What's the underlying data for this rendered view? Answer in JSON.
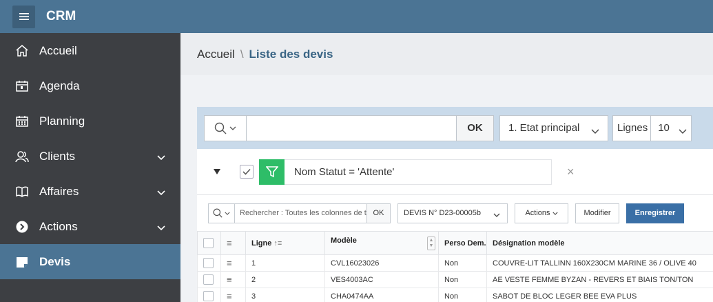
{
  "header": {
    "title": "CRM"
  },
  "sidebar": {
    "items": [
      {
        "label": "Accueil",
        "icon": "home-icon",
        "has_chevron": false,
        "active": false
      },
      {
        "label": "Agenda",
        "icon": "calendar-icon",
        "has_chevron": false,
        "active": false
      },
      {
        "label": "Planning",
        "icon": "planning-icon",
        "has_chevron": false,
        "active": false
      },
      {
        "label": "Clients",
        "icon": "users-icon",
        "has_chevron": true,
        "active": false
      },
      {
        "label": "Affaires",
        "icon": "book-icon",
        "has_chevron": true,
        "active": false
      },
      {
        "label": "Actions",
        "icon": "arrow-circle-icon",
        "has_chevron": true,
        "active": false
      },
      {
        "label": "Devis",
        "icon": "document-icon",
        "has_chevron": false,
        "active": true
      }
    ]
  },
  "breadcrumb": {
    "root": "Accueil",
    "separator": "\\",
    "current": "Liste des devis"
  },
  "search": {
    "value": "",
    "ok_label": "OK",
    "report_select": "1. Etat principal",
    "lines_label": "Lignes",
    "lines_value": "10"
  },
  "filter": {
    "text": "Nom Statut = 'Attente'",
    "close": "×"
  },
  "grid_toolbar": {
    "placeholder": "Rechercher : Toutes les colonnes de t",
    "ok_label": "OK",
    "report_select": "DEVIS N° D23-00005b",
    "actions_label": "Actions",
    "modify_label": "Modifier",
    "save_label": "Enregistrer"
  },
  "grid": {
    "columns": [
      "Ligne",
      "Modèle",
      "Perso Dem.",
      "Désignation modèle"
    ],
    "rows": [
      {
        "ligne": "1",
        "modele": "CVL16023026",
        "perso": "Non",
        "designation": "COUVRE-LIT TALLINN 160X230CM MARINE 36 / OLIVE 40"
      },
      {
        "ligne": "2",
        "modele": "VES4003AC",
        "perso": "Non",
        "designation": "AE VESTE FEMME BYZAN - REVERS ET BIAIS TON/TON"
      },
      {
        "ligne": "3",
        "modele": "CHA0474AA",
        "perso": "Non",
        "designation": "SABOT DE BLOC LEGER BEE EVA PLUS"
      }
    ]
  },
  "colors": {
    "header_bg": "#4b7494",
    "sidebar_bg": "#3d3f43",
    "active_bg": "#4b7494",
    "filter_green": "#2ebd68",
    "save_blue": "#3a6fa6"
  }
}
